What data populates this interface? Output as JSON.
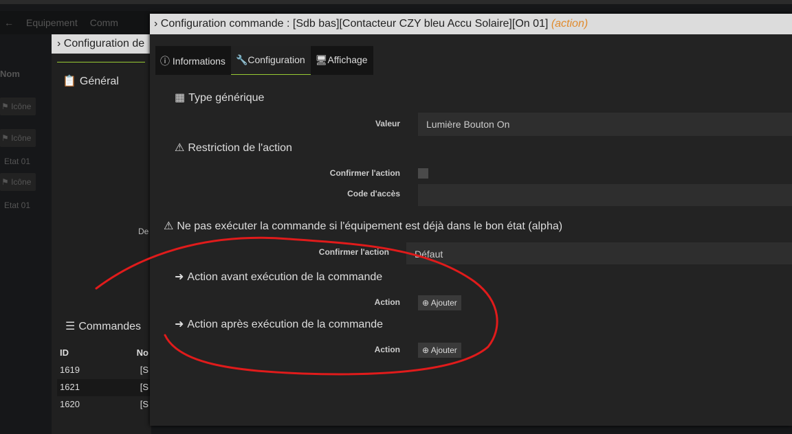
{
  "background": {
    "nav": [
      "Equipement",
      "Comm"
    ],
    "col": {
      "nom": "Nom",
      "icone": "Icône",
      "etat": "Etat 01"
    }
  },
  "middle": {
    "title": "Configuration de",
    "general": "Général",
    "de": "De",
    "commandes": "Commandes",
    "table": {
      "headers": [
        "ID",
        "No"
      ],
      "rows": [
        [
          "1619",
          "[S"
        ],
        [
          "1621",
          "[S"
        ],
        [
          "1620",
          "[S"
        ]
      ]
    }
  },
  "modal": {
    "title": "Configuration commande : [Sdb bas][Contacteur CZY bleu Accu Solaire][On 01]",
    "title_tag": "(action)",
    "tabs": [
      "Informations",
      "Configuration",
      "Affichage"
    ],
    "type_generique": {
      "title": "Type générique",
      "label": "Valeur",
      "value": "Lumière Bouton On"
    },
    "restriction": {
      "title": "Restriction de l'action",
      "confirm_label": "Confirmer l'action",
      "code_label": "Code d'accès",
      "code_value": ""
    },
    "alpha": {
      "title": "Ne pas exécuter la commande si l'équipement est déjà dans le bon état (alpha)",
      "label": "Confirmer l'action",
      "value": "Défaut"
    },
    "avant": {
      "title": "Action avant exécution de la commande",
      "label": "Action",
      "button": "Ajouter"
    },
    "apres": {
      "title": "Action après exécution de la commande",
      "label": "Action",
      "button": "Ajouter"
    }
  },
  "colors": {
    "accent": "#99cc33",
    "action_tag": "#e08a2c",
    "annotation": "#e01b1b"
  }
}
